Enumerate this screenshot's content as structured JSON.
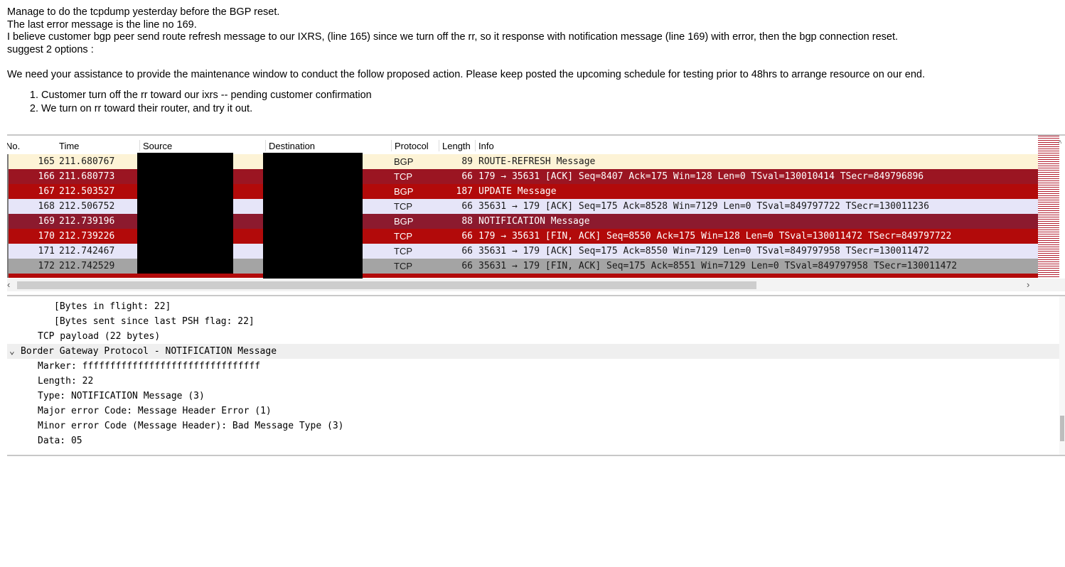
{
  "email": {
    "lines": [
      "Manage to do the tcpdump yesterday before the BGP reset.",
      "The last error message is the line no 169.",
      "I believe customer bgp peer send route refresh message to our IXRS, (line 165) since we turn off the rr, so it response with notification message (line 169)  with error, then the bgp connection reset.",
      "suggest 2 options :"
    ],
    "paragraph": "We need your assistance to provide the maintenance window to conduct the follow proposed action. Please keep posted the upcoming schedule for testing prior to 48hrs to arrange resource on our end.",
    "options": [
      "Customer turn off the rr toward our ixrs  -- pending customer confirmation",
      "We turn on rr toward their router, and try it out."
    ]
  },
  "packet_list": {
    "columns": [
      "No.",
      "Time",
      "Source",
      "Destination",
      "Protocol",
      "Length",
      "Info"
    ],
    "rows": [
      {
        "no": "165",
        "time": "211.680767",
        "protocol": "BGP",
        "length": "89",
        "info": "ROUTE-REFRESH Message",
        "bg": "#fdf3d6",
        "fg": "#1a1a1a"
      },
      {
        "no": "166",
        "time": "211.680773",
        "protocol": "TCP",
        "length": "66",
        "info": "179 → 35631 [ACK] Seq=8407 Ack=175 Win=128 Len=0 TSval=130010414 TSecr=849796896",
        "bg": "#9b1522",
        "fg": "#ffffff"
      },
      {
        "no": "167",
        "time": "212.503527",
        "protocol": "BGP",
        "length": "187",
        "info": "UPDATE Message",
        "bg": "#b20a0a",
        "fg": "#ffffff"
      },
      {
        "no": "168",
        "time": "212.506752",
        "protocol": "TCP",
        "length": "66",
        "info": "35631 → 179 [ACK] Seq=175 Ack=8528 Win=7129 Len=0 TSval=849797722 TSecr=130011236",
        "bg": "#e6e5f8",
        "fg": "#1a1a1a"
      },
      {
        "no": "169",
        "time": "212.739196",
        "protocol": "BGP",
        "length": "88",
        "info": "NOTIFICATION Message",
        "bg": "#8c1a2e",
        "fg": "#ffffff"
      },
      {
        "no": "170",
        "time": "212.739226",
        "protocol": "TCP",
        "length": "66",
        "info": "179 → 35631 [FIN, ACK] Seq=8550 Ack=175 Win=128 Len=0 TSval=130011472 TSecr=849797722",
        "bg": "#b20a0a",
        "fg": "#ffffff"
      },
      {
        "no": "171",
        "time": "212.742467",
        "protocol": "TCP",
        "length": "66",
        "info": "35631 → 179 [ACK] Seq=175 Ack=8550 Win=7129 Len=0 TSval=849797958 TSecr=130011472",
        "bg": "#e6e5f8",
        "fg": "#1a1a1a"
      },
      {
        "no": "172",
        "time": "212.742529",
        "protocol": "TCP",
        "length": "66",
        "info": "35631 → 179 [FIN, ACK] Seq=175 Ack=8551 Win=7129 Len=0 TSval=849797958 TSecr=130011472",
        "bg": "#a4a4a4",
        "fg": "#1a1a1a"
      }
    ]
  },
  "detail_pane": {
    "lines": [
      {
        "text": "[Bytes in flight: 22]",
        "indent": 2
      },
      {
        "text": "[Bytes sent since last PSH flag: 22]",
        "indent": 2
      },
      {
        "text": "TCP payload (22 bytes)",
        "indent": 1
      },
      {
        "text": "Border Gateway Protocol - NOTIFICATION Message",
        "indent": 0,
        "expander": "⌄",
        "highlight": true
      },
      {
        "text": "Marker: ffffffffffffffffffffffffffffffff",
        "indent": 1
      },
      {
        "text": "Length: 22",
        "indent": 1
      },
      {
        "text": "Type: NOTIFICATION Message (3)",
        "indent": 1
      },
      {
        "text": "Major error Code: Message Header Error (1)",
        "indent": 1
      },
      {
        "text": "Minor error Code (Message Header): Bad Message Type (3)",
        "indent": 1
      },
      {
        "text": "Data: 05",
        "indent": 1
      }
    ]
  },
  "scroll_icons": {
    "left": "‹",
    "right": "›",
    "up": "˄",
    "down": "˅"
  }
}
